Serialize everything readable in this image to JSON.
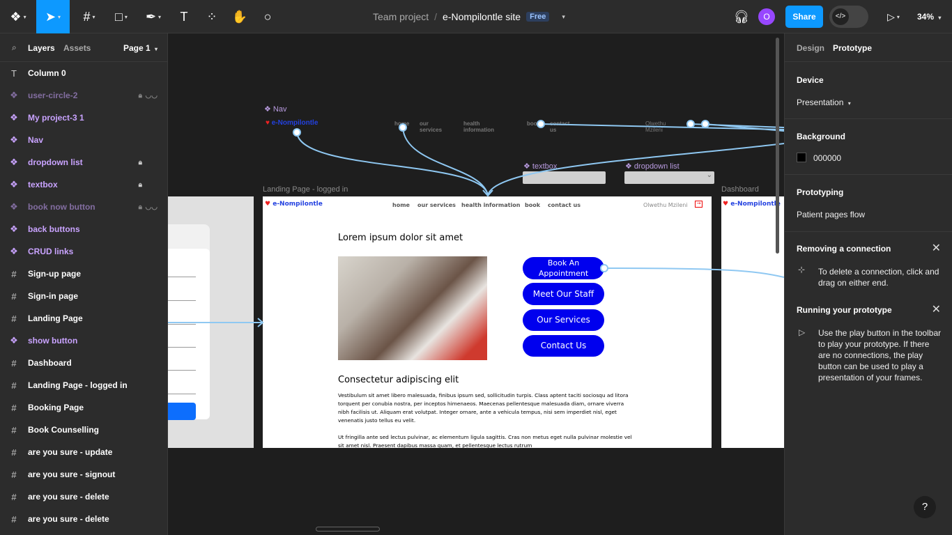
{
  "toolbar": {
    "project": "Team project",
    "separator": "/",
    "file": "e-Nompilontle site",
    "plan_badge": "Free",
    "avatar_initial": "O",
    "share": "Share",
    "zoom": "34%"
  },
  "left_panel": {
    "tabs": [
      "Layers",
      "Assets"
    ],
    "page": "Page 1",
    "layers": [
      {
        "name": "Column 0",
        "type": "text"
      },
      {
        "name": "user-circle-2",
        "type": "component",
        "locked": true,
        "hidden": true
      },
      {
        "name": "My project-3 1",
        "type": "component"
      },
      {
        "name": "Nav",
        "type": "component"
      },
      {
        "name": "dropdown list",
        "type": "component",
        "locked": true
      },
      {
        "name": "textbox",
        "type": "component",
        "locked": true
      },
      {
        "name": "book now button",
        "type": "component",
        "locked": true,
        "hidden": true
      },
      {
        "name": "back buttons",
        "type": "component"
      },
      {
        "name": "CRUD links",
        "type": "component"
      },
      {
        "name": "Sign-up page",
        "type": "frame"
      },
      {
        "name": "Sign-in page",
        "type": "frame"
      },
      {
        "name": "Landing Page",
        "type": "frame"
      },
      {
        "name": "show button",
        "type": "component"
      },
      {
        "name": "Dashboard",
        "type": "frame"
      },
      {
        "name": "Landing Page - logged in",
        "type": "frame"
      },
      {
        "name": "Booking Page",
        "type": "frame"
      },
      {
        "name": "Book Counselling",
        "type": "frame"
      },
      {
        "name": "are you sure - update",
        "type": "frame"
      },
      {
        "name": "are you sure - signout",
        "type": "frame"
      },
      {
        "name": "are you sure - delete",
        "type": "frame"
      },
      {
        "name": "are you sure - delete",
        "type": "frame"
      }
    ]
  },
  "canvas": {
    "nav_component_label": "Nav",
    "textbox_label": "textbox",
    "dropdown_label": "dropdown list",
    "frame_label": "Landing Page - logged in",
    "dashboard_label": "Dashboard",
    "logo": "e-Nompilontle",
    "nav_links": [
      "home",
      "our services",
      "health information",
      "book",
      "contact us"
    ],
    "user_name": "Olwethu Mzileni",
    "heading1": "Lorem ipsum dolor sit amet",
    "buttons": [
      "Book An Appointment",
      "Meet Our Staff",
      "Our Services",
      "Contact Us"
    ],
    "heading2": "Consectetur adipiscing elit",
    "para1": "Vestibulum sit amet libero malesuada, finibus ipsum sed, sollicitudin turpis. Class aptent taciti sociosqu ad litora torquent per conubia nostra, per inceptos himenaeos. Maecenas pellentesque malesuada diam, ornare viverra nibh facilisis ut. Aliquam erat volutpat. Integer ornare, ante a vehicula tempus, nisi sem imperdiet nisl, eget venenatis justo tellus eu velit.",
    "para2": "Ut fringilla ante sed lectus pulvinar, ac elementum ligula sagittis. Cras non metus eget nulla pulvinar molestie vel sit amet nisl. Praesent dapibus massa quam, et pellentesque lectus rutrum"
  },
  "right_panel": {
    "tabs": [
      "Design",
      "Prototype"
    ],
    "device_title": "Device",
    "device": "Presentation",
    "background_title": "Background",
    "background": "000000",
    "prototyping_title": "Prototyping",
    "flow": "Patient pages flow",
    "remove_title": "Removing a connection",
    "remove_text": "To delete a connection, click and drag on either end.",
    "running_title": "Running your prototype",
    "running_text": "Use the play button in the toolbar to play your prototype. If there are no connections, the play button can be used to play a presentation of your frames.",
    "help": "?"
  }
}
